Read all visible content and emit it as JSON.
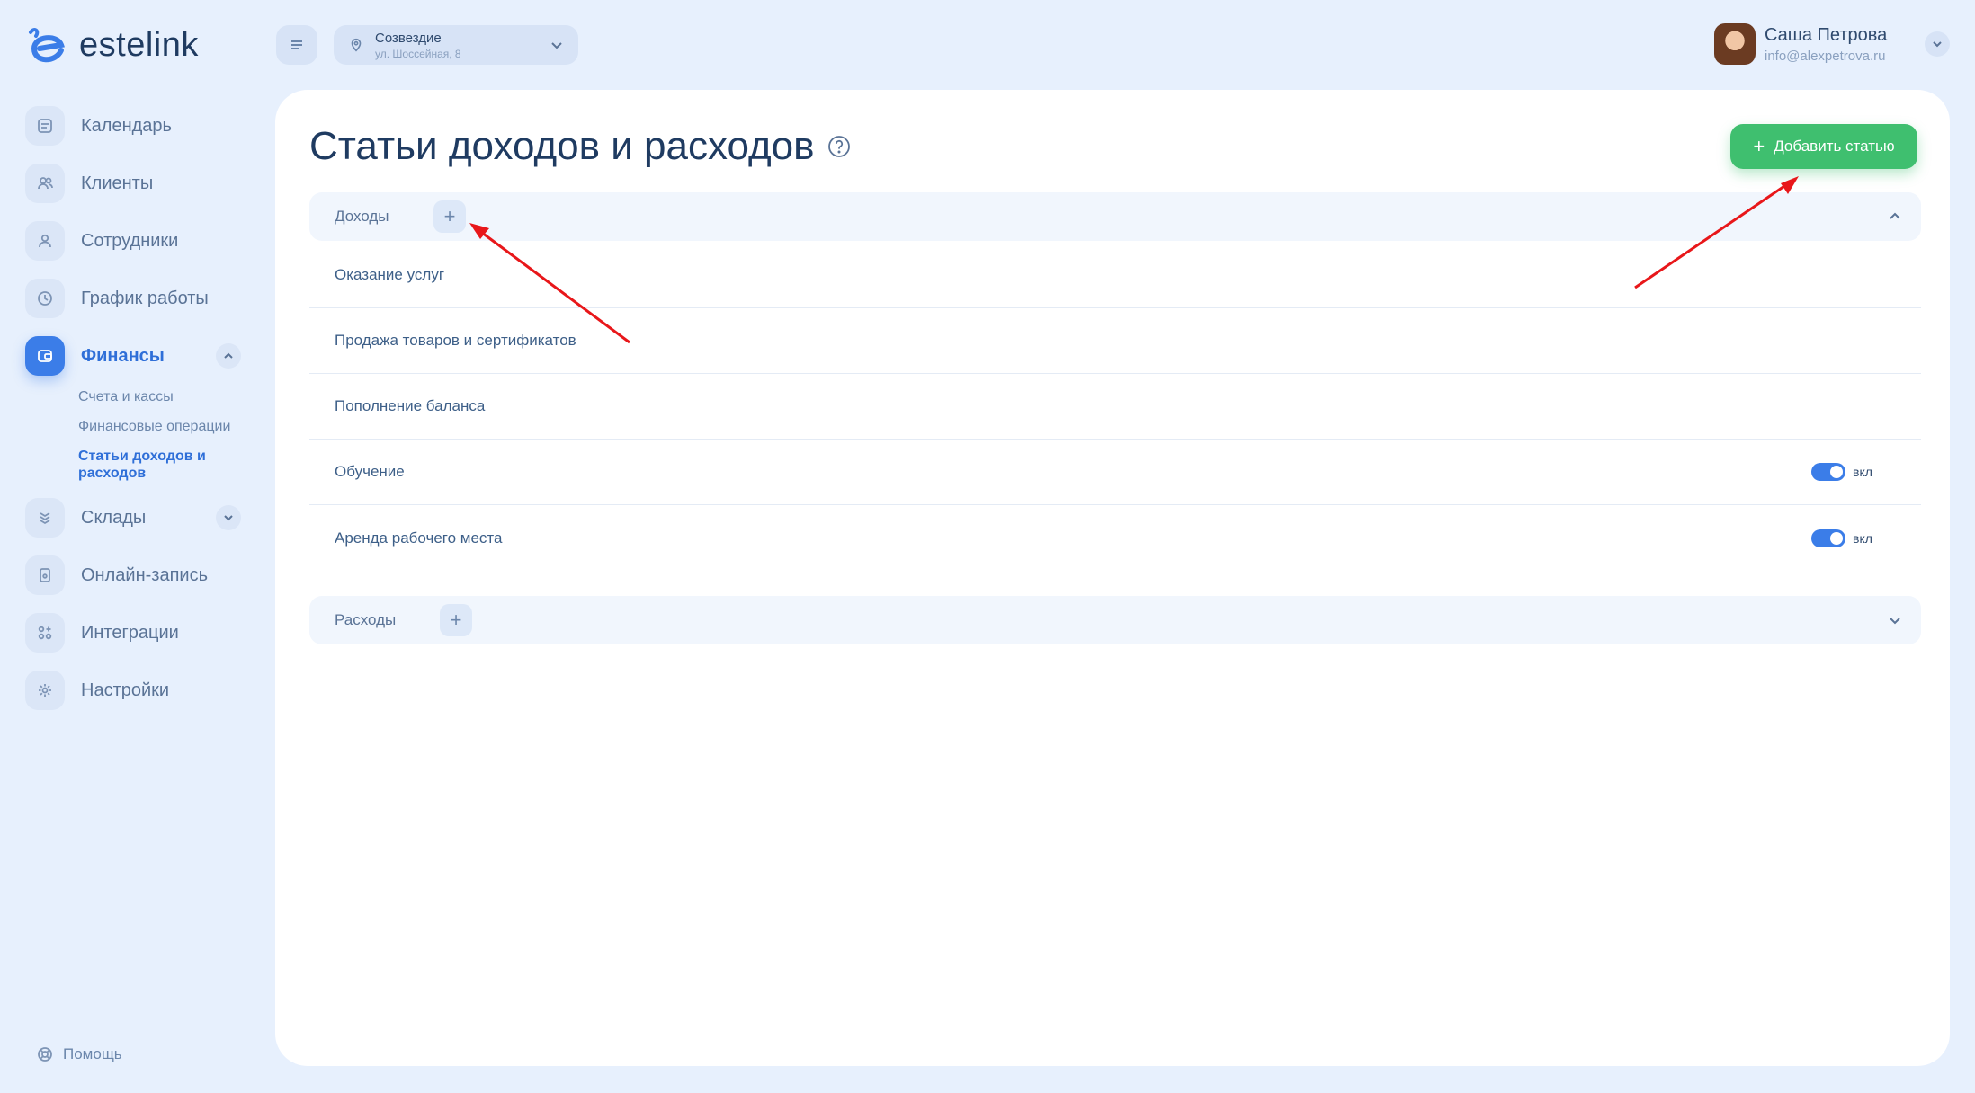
{
  "brand": {
    "name": "estelink"
  },
  "sidebar": {
    "items": [
      {
        "label": "Календарь",
        "icon": "calendar-icon"
      },
      {
        "label": "Клиенты",
        "icon": "clients-icon"
      },
      {
        "label": "Сотрудники",
        "icon": "employee-icon"
      },
      {
        "label": "График работы",
        "icon": "clock-icon"
      },
      {
        "label": "Финансы",
        "icon": "wallet-icon",
        "active": true,
        "expanded": true
      },
      {
        "label": "Склады",
        "icon": "warehouse-icon",
        "expanded": false
      },
      {
        "label": "Онлайн-запись",
        "icon": "online-booking-icon"
      },
      {
        "label": "Интеграции",
        "icon": "integrations-icon"
      },
      {
        "label": "Настройки",
        "icon": "gear-icon"
      }
    ],
    "finance_sub": [
      {
        "label": "Счета и кассы"
      },
      {
        "label": "Финансовые операции"
      },
      {
        "label": "Статьи доходов и расходов",
        "active": true
      }
    ],
    "help_label": "Помощь"
  },
  "topbar": {
    "location": {
      "name": "Созвездие",
      "address": "ул. Шоссейная, 8"
    },
    "user": {
      "name": "Саша Петрова",
      "email": "info@alexpetrova.ru"
    }
  },
  "main": {
    "title": "Статьи доходов и расходов",
    "add_button_label": "Добавить статью",
    "income": {
      "label": "Доходы",
      "expanded": true,
      "rows": [
        {
          "label": "Оказание услуг",
          "has_toggle": false
        },
        {
          "label": "Продажа товаров и сертификатов",
          "has_toggle": false
        },
        {
          "label": "Пополнение баланса",
          "has_toggle": false
        },
        {
          "label": "Обучение",
          "has_toggle": true,
          "toggle_on": true,
          "toggle_text": "вкл"
        },
        {
          "label": "Аренда рабочего места",
          "has_toggle": true,
          "toggle_on": true,
          "toggle_text": "вкл"
        }
      ]
    },
    "expenses": {
      "label": "Расходы",
      "expanded": false
    }
  },
  "colors": {
    "accent": "#3b7de8",
    "success": "#3fbf6f",
    "background": "#e7f0fd",
    "annotation_arrow": "#e8171a"
  }
}
